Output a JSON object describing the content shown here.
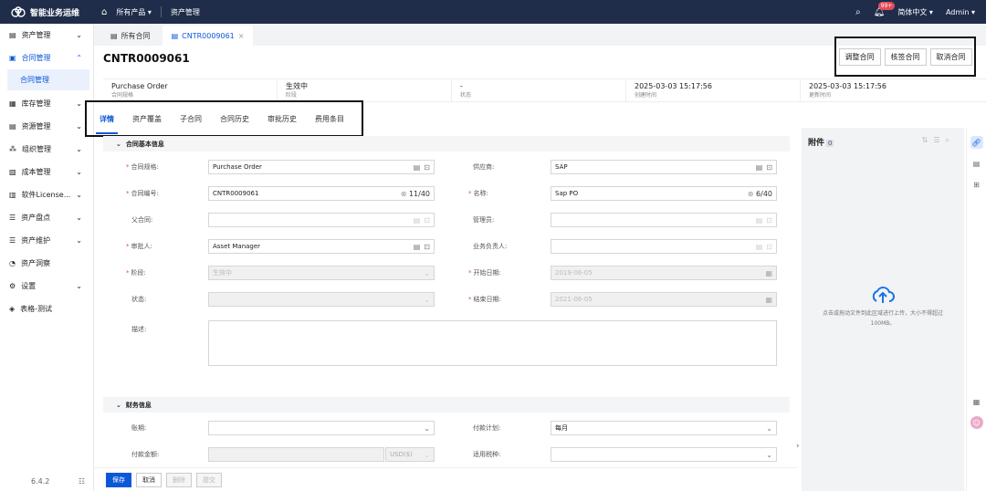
{
  "header": {
    "brand": "智能业务运维",
    "all_products": "所有产品",
    "asset_management": "资产管理",
    "notifications_badge": "99+",
    "language": "简体中文",
    "user": "Admin"
  },
  "sidebar": {
    "items": [
      {
        "label": "资产管理",
        "icon": "asset-icon"
      },
      {
        "label": "合同管理",
        "icon": "contract-icon",
        "sub": "合同管理"
      },
      {
        "label": "库存管理",
        "icon": "inventory-icon"
      },
      {
        "label": "资源管理",
        "icon": "resource-icon"
      },
      {
        "label": "组织管理",
        "icon": "org-icon"
      },
      {
        "label": "成本管理",
        "icon": "cost-icon"
      },
      {
        "label": "软件License...",
        "icon": "license-icon"
      },
      {
        "label": "资产盘点",
        "icon": "stocktake-icon"
      },
      {
        "label": "资产维护",
        "icon": "maintenance-icon"
      },
      {
        "label": "资产洞察",
        "icon": "insight-icon"
      },
      {
        "label": "设置",
        "icon": "settings-icon"
      },
      {
        "label": "表格-测试",
        "icon": "table-test-icon"
      }
    ],
    "version": "6.4.2"
  },
  "page_tabs": [
    {
      "label": "所有合同"
    },
    {
      "label": "CNTR0009061"
    }
  ],
  "title": "CNTR0009061",
  "actions": {
    "adjust": "调整合同",
    "verify": "核签合同",
    "cancel": "取消合同"
  },
  "summary": [
    {
      "value": "Purchase Order",
      "key": "合同规格"
    },
    {
      "value": "生效中",
      "key": "阶段"
    },
    {
      "value": "-",
      "key": "状态"
    },
    {
      "value": "2025-03-03 15:17:56",
      "key": "创建时间"
    },
    {
      "value": "2025-03-03 15:17:56",
      "key": "更新时间"
    }
  ],
  "detail_tabs": [
    "详情",
    "资产覆盖",
    "子合同",
    "合同历史",
    "审批历史",
    "费用条目"
  ],
  "form": {
    "section_basic": "合同基本信息",
    "section_finance": "财务信息",
    "spec_label": "合同规格:",
    "spec_value": "Purchase Order",
    "supplier_label": "供应商:",
    "supplier_value": "SAP",
    "number_label": "合同编号:",
    "number_value": "CNTR0009061",
    "number_count": "11/40",
    "name_label": "名称:",
    "name_value": "Sap PO",
    "name_count": "6/40",
    "parent_label": "父合同:",
    "admin_label": "管理员:",
    "approver_label": "审批人:",
    "approver_value": "Asset Manager",
    "owner_label": "业务负责人:",
    "stage_label": "阶段:",
    "stage_value": "生效中",
    "start_label": "开始日期:",
    "start_value": "2019-06-05",
    "status_label": "状态:",
    "end_label": "结束日期:",
    "end_value": "2021-06-05",
    "desc_label": "描述:",
    "term_label": "账期:",
    "payplan_label": "付款计划:",
    "payplan_value": "每月",
    "amount_label": "付款金额:",
    "currency": "USD($)",
    "tax_label": "适用税种:"
  },
  "footer": {
    "save": "保存",
    "cancel": "取消",
    "delete": "删除",
    "submit": "提交"
  },
  "attachment": {
    "title": "附件",
    "count": "0",
    "upload_hint_1": "点击或拖动文件到此区域进行上传，大小不得超过",
    "upload_hint_2": "100MB。"
  }
}
